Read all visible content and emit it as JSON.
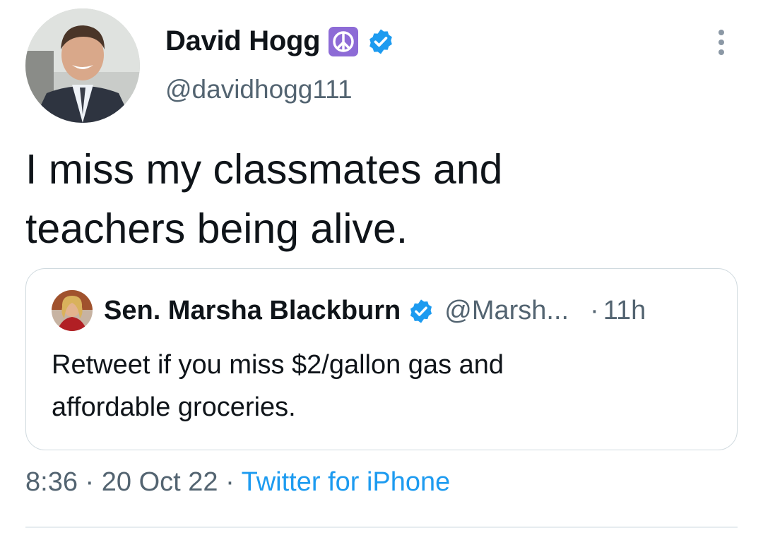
{
  "author": {
    "name": "David Hogg",
    "emoji_badge": "☮",
    "handle": "@davidhogg111",
    "verified": true,
    "avatar_icon": "user-photo"
  },
  "tweet": {
    "text": "I miss my classmates and\nteachers being alive."
  },
  "quoted_tweet": {
    "name": "Sen. Marsha Blackburn",
    "handle": "@Marsh...",
    "separator": "·",
    "time": "11h",
    "verified": true,
    "text": "Retweet if you miss $2/gallon gas and\naffordable groceries."
  },
  "meta": {
    "time": "8:36",
    "sep1": " · ",
    "date": "20 Oct 22",
    "sep2": " · ",
    "source": "Twitter for iPhone"
  },
  "colors": {
    "accent": "#1d9bf0",
    "secondary_text": "#536471",
    "peace_badge": "#8d6bd6",
    "border": "#cfd9de"
  }
}
